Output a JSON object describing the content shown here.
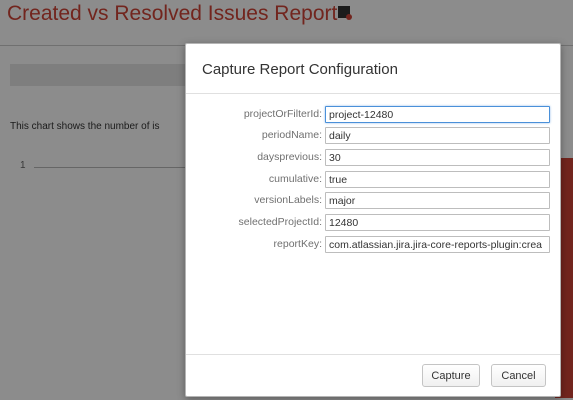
{
  "background": {
    "report_title": "Created vs Resolved Issues Report",
    "report_icon": "report-icon",
    "description": "This chart shows the number of is",
    "axis_value": "1",
    "accent_color": "#d04437"
  },
  "dialog": {
    "title": "Capture Report Configuration",
    "fields": [
      {
        "label": "projectOrFilterId:",
        "value": "project-12480"
      },
      {
        "label": "periodName:",
        "value": "daily"
      },
      {
        "label": "daysprevious:",
        "value": "30"
      },
      {
        "label": "cumulative:",
        "value": "true"
      },
      {
        "label": "versionLabels:",
        "value": "major"
      },
      {
        "label": "selectedProjectId:",
        "value": "12480"
      },
      {
        "label": "reportKey:",
        "value": "com.atlassian.jira.jira-core-reports-plugin:crea"
      }
    ],
    "buttons": {
      "capture": "Capture",
      "cancel": "Cancel"
    }
  }
}
